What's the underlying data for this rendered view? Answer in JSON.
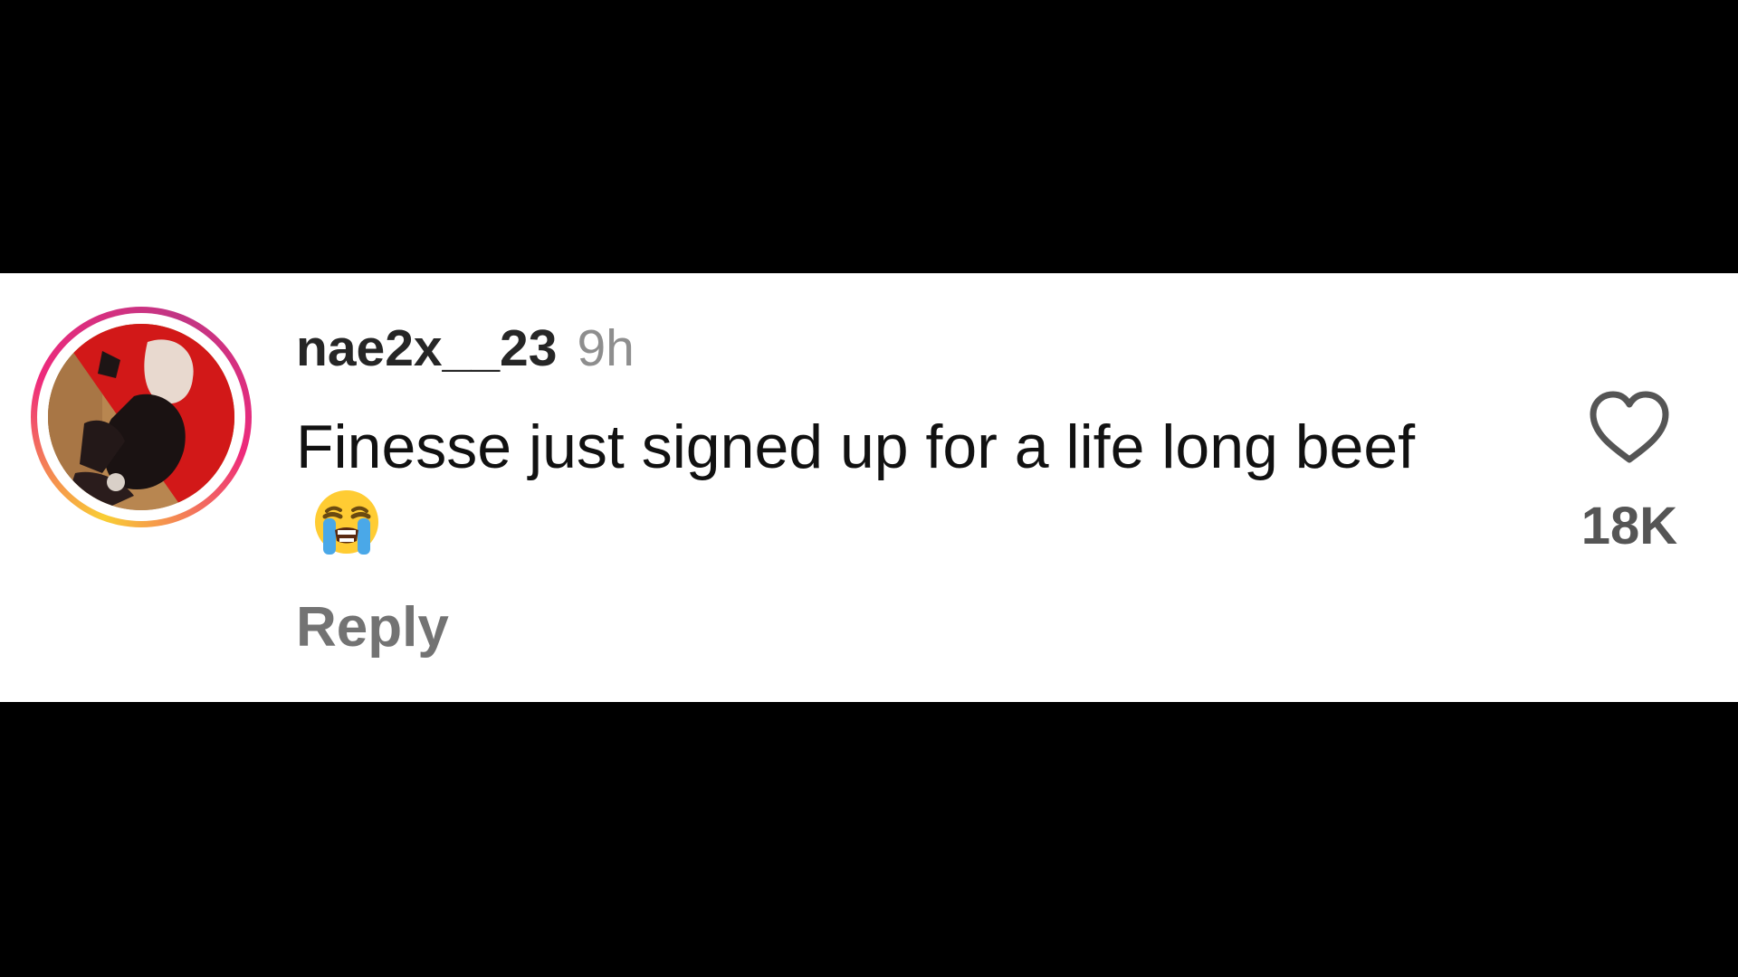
{
  "comment": {
    "username": "nae2x__23",
    "timestamp": "9h",
    "text": "Finesse just signed up for a life long beef",
    "emoji": "loudly-crying-face",
    "reply_label": "Reply"
  },
  "like": {
    "icon": "heart-icon",
    "count": "18K"
  },
  "colors": {
    "background_bars": "#000000",
    "comment_background": "#ffffff",
    "username": "#262626",
    "meta": "#8e8e8e",
    "reply": "#737373",
    "story_ring": [
      "#f9ce34",
      "#ee2a7b",
      "#c13584"
    ]
  }
}
